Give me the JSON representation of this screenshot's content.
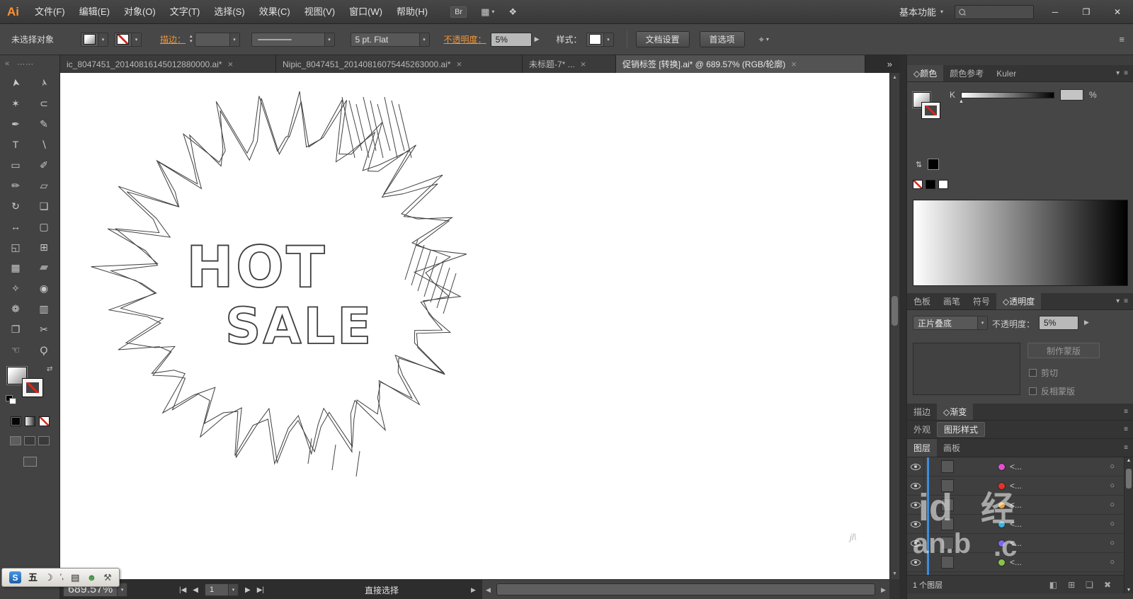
{
  "icons": {
    "close": "×",
    "close_x": "✕",
    "minimize": "─",
    "restore": "❐",
    "search": "Ϙ",
    "chevron_down": "▾",
    "chevron_right": "▶",
    "grid": "▦",
    "cslive": "❖",
    "extra": "⌖",
    "menu": "≡",
    "overflow": "»",
    "collapse_left": "«",
    "grip": "�server⋯",
    "grip_dots": "⋯⋯",
    "up": "▲",
    "down": "▼",
    "left": "◀",
    "right": "▶",
    "first": "|◀",
    "last": "▶|",
    "target": "○",
    "swap": "⇄",
    "swap_v": "⇅",
    "stepper_up": "▴",
    "stepper_down": "▾"
  },
  "menubar": {
    "logo": "Ai",
    "items": [
      "文件(F)",
      "编辑(E)",
      "对象(O)",
      "文字(T)",
      "选择(S)",
      "效果(C)",
      "视图(V)",
      "窗口(W)",
      "帮助(H)"
    ],
    "bridge_label": "Br",
    "workspace_label": "基本功能"
  },
  "controlbar": {
    "status": "未选择对象",
    "stroke_link": "描边：",
    "brush_value": "5 pt. Flat",
    "opacity_link": "不透明度：",
    "opacity_value": "5%",
    "style_label": "样式：",
    "doc_setup": "文档设置",
    "preferences": "首选项"
  },
  "tabs": {
    "items": [
      {
        "label": "ic_8047451_20140816145012880000.ai*",
        "active": false
      },
      {
        "label": "Nipic_8047451_20140816075445263000.ai*",
        "active": false
      },
      {
        "label": "未标题-7* ...",
        "active": false
      },
      {
        "label": "促销标签 [转换].ai* @ 689.57% (RGB/轮廓)",
        "active": true
      }
    ],
    "overflow": "»"
  },
  "toolbar": {
    "tools": [
      {
        "name": "selection-tool",
        "glyph": "➤"
      },
      {
        "name": "direct-selection-tool",
        "glyph": "➢"
      },
      {
        "name": "magic-wand-tool",
        "glyph": "✶"
      },
      {
        "name": "lasso-tool",
        "glyph": "⊂"
      },
      {
        "name": "pen-tool",
        "glyph": "✒"
      },
      {
        "name": "add-anchor-tool",
        "glyph": "✎"
      },
      {
        "name": "type-tool",
        "glyph": "T"
      },
      {
        "name": "line-segment-tool",
        "glyph": "∖"
      },
      {
        "name": "rectangle-tool",
        "glyph": "▭"
      },
      {
        "name": "paintbrush-tool",
        "glyph": "✐"
      },
      {
        "name": "pencil-tool",
        "glyph": "✏"
      },
      {
        "name": "eraser-tool",
        "glyph": "▱"
      },
      {
        "name": "rotate-tool",
        "glyph": "↻"
      },
      {
        "name": "scale-tool",
        "glyph": "❏"
      },
      {
        "name": "width-tool",
        "glyph": "↔"
      },
      {
        "name": "free-transform-tool",
        "glyph": "▢"
      },
      {
        "name": "shape-builder-tool",
        "glyph": "◱"
      },
      {
        "name": "perspective-grid-tool",
        "glyph": "⊞"
      },
      {
        "name": "mesh-tool",
        "glyph": "▦"
      },
      {
        "name": "gradient-tool",
        "glyph": "▰"
      },
      {
        "name": "eyedropper-tool",
        "glyph": "✧"
      },
      {
        "name": "blend-tool",
        "glyph": "◉"
      },
      {
        "name": "symbol-sprayer-tool",
        "glyph": "❁"
      },
      {
        "name": "column-graph-tool",
        "glyph": "▥"
      },
      {
        "name": "artboard-tool",
        "glyph": "❐"
      },
      {
        "name": "slice-tool",
        "glyph": "✂"
      },
      {
        "name": "hand-tool",
        "glyph": "☜"
      },
      {
        "name": "zoom-tool",
        "glyph": "Ϙ"
      }
    ]
  },
  "artwork": {
    "line1": "HOT",
    "line2": "SALE",
    "watermark_small": "jl\\"
  },
  "statusbar": {
    "zoom": "689.57%",
    "artboard": "1",
    "tool": "直接选择"
  },
  "dock": {
    "color_tabs": [
      "◇颜色",
      "颜色参考",
      "Kuler"
    ],
    "mid_tabs": [
      "色板",
      "画笔",
      "符号",
      "◇透明度"
    ],
    "stroke_gradient_tabs": [
      "描边",
      "◇渐变"
    ],
    "appearance_tabs": [
      "外观",
      "图形样式"
    ],
    "layers_tabs": [
      "图层",
      "画板"
    ],
    "active_tabs": {
      "color-tabs": 0,
      "mid-tabs": 3,
      "sg-tabs": 1,
      "ap-tabs": 1,
      "ly-tabs": 0
    },
    "k_label": "K",
    "percent": "%",
    "transparency": {
      "blend_mode": "正片叠底",
      "opacity_label": "不透明度：",
      "opacity_value": "5%",
      "make_mask": "制作蒙版",
      "clip": "剪切",
      "invert": "反相蒙版"
    },
    "layers": {
      "rows": [
        {
          "label": "<...",
          "color": "#e24fd0"
        },
        {
          "label": "<...",
          "color": "#e8312a"
        },
        {
          "label": "<...",
          "color": "#e8a33d"
        },
        {
          "label": "<...",
          "color": "#3bb3e0"
        },
        {
          "label": "<...",
          "color": "#7b68ee"
        },
        {
          "label": "<...",
          "color": "#8bc34a"
        }
      ],
      "footer_label": "1 个图层",
      "footer_icons": [
        {
          "name": "make-clipping-mask-icon",
          "glyph": "◧"
        },
        {
          "name": "new-sublayer-icon",
          "glyph": "⊞"
        },
        {
          "name": "new-layer-icon",
          "glyph": "❏"
        },
        {
          "name": "delete-layer-icon",
          "glyph": "✖"
        }
      ]
    }
  },
  "ime": {
    "logo": "S",
    "wubi": "五",
    "moon": "☽",
    "punct": "’,",
    "keyboard": "▤",
    "user": "☻",
    "tools": "⚒"
  },
  "watermark": {
    "t1": "id",
    "t2": "经",
    "t3": "an.b",
    "t4": ".c"
  }
}
